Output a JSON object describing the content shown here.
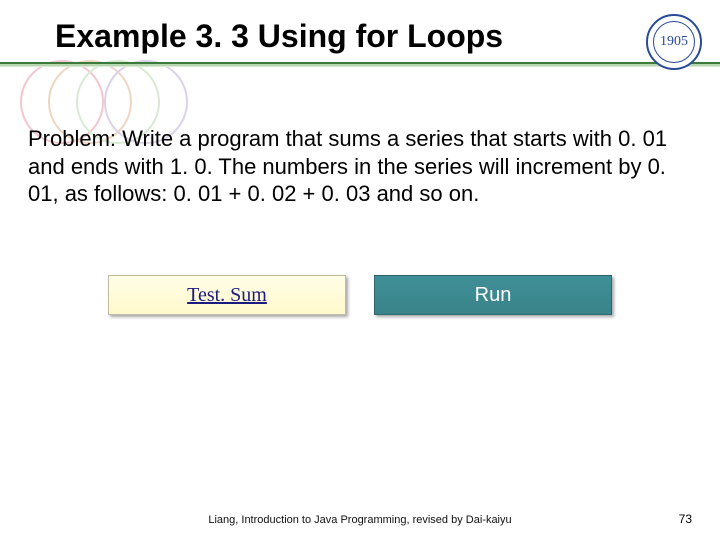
{
  "title": "Example 3. 3 Using for Loops",
  "body": "Problem: Write a program that sums a series that starts with 0. 01 and ends with 1. 0. The numbers in the series will increment by 0. 01, as follows: 0. 01 + 0. 02 + 0. 03 and so on.",
  "link_button_label": "Test. Sum",
  "run_button_label": "Run",
  "footer": "Liang, Introduction to Java Programming, revised by Dai-kaiyu",
  "page_number": "73",
  "logo_year": "1905"
}
